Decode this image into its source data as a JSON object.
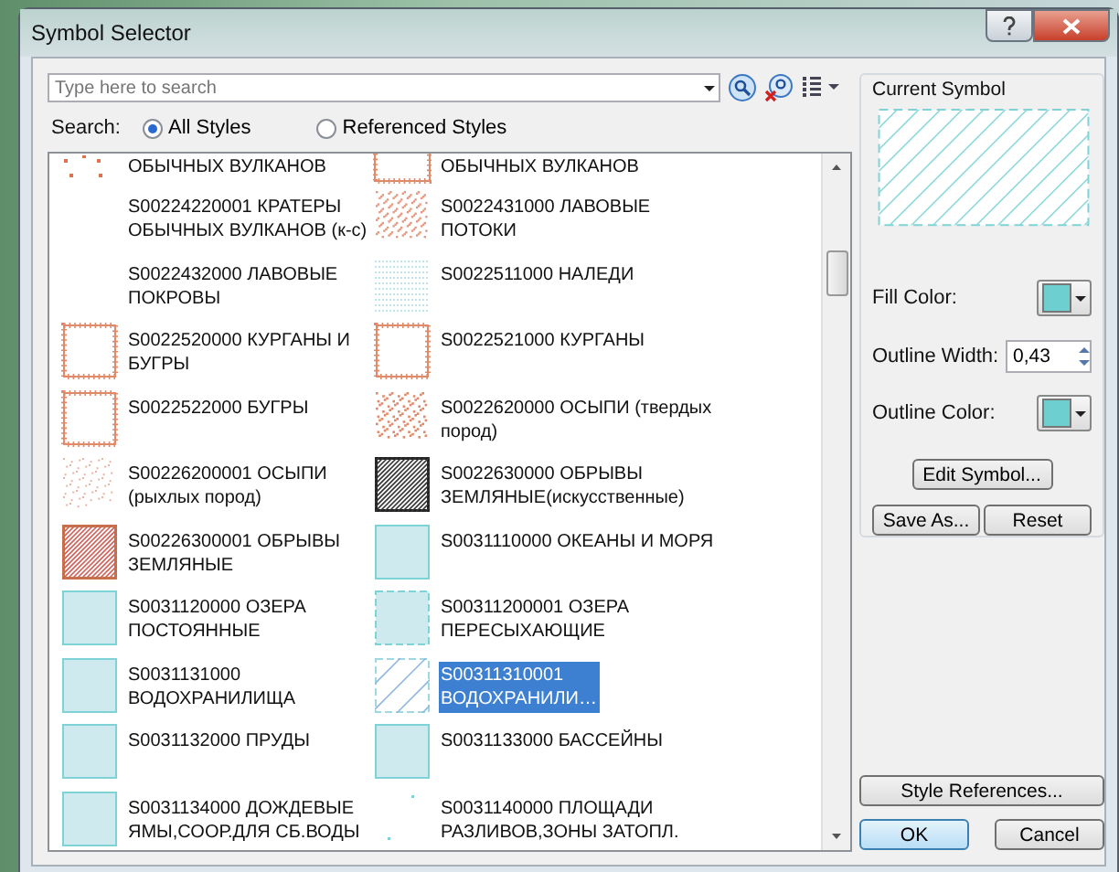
{
  "window": {
    "title": "Symbol Selector"
  },
  "search": {
    "placeholder": "Type here to search"
  },
  "search_scope": {
    "label": "Search:",
    "options": [
      {
        "label": "All Styles",
        "selected": true
      },
      {
        "label": "Referenced Styles",
        "selected": false
      }
    ]
  },
  "symbols": [
    {
      "kind": "volcano_dots",
      "label": "ОБЫЧНЫХ ВУЛКАНОВ",
      "selected": false
    },
    {
      "kind": "tick_box_cut",
      "label": "ОБЫЧНЫХ ВУЛКАНОВ",
      "selected": false
    },
    {
      "kind": "blank",
      "label": "S00224220001 КРАТЕРЫ\nОБЫЧНЫХ ВУЛКАНОВ (к-с)",
      "selected": false
    },
    {
      "kind": "lava",
      "label": "S0022431000 ЛАВОВЫЕ\nПОТОКИ",
      "selected": false
    },
    {
      "kind": "blank",
      "label": "S0022432000 ЛАВОВЫЕ\nПОКРОВЫ",
      "selected": false
    },
    {
      "kind": "ice",
      "label": "S0022511000 НАЛЕДИ",
      "selected": false
    },
    {
      "kind": "tick_box",
      "label": "S0022520000 КУРГАНЫ И\nБУГРЫ",
      "selected": false
    },
    {
      "kind": "tick_box",
      "label": "S0022521000 КУРГАНЫ",
      "selected": false
    },
    {
      "kind": "tick_box",
      "label": "S0022522000 БУГРЫ",
      "selected": false
    },
    {
      "kind": "scree",
      "label": "S0022620000 ОСЫПИ (твердых\nпород)",
      "selected": false
    },
    {
      "kind": "scree_sparse",
      "label": "S00226200001 ОСЫПИ\n(рыхлых пород)",
      "selected": false
    },
    {
      "kind": "hatch_black",
      "label": "S0022630000 ОБРЫВЫ\nЗЕМЛЯНЫЕ(искусственные)",
      "selected": false
    },
    {
      "kind": "hatch_brown",
      "label": "S00226300001 ОБРЫВЫ\nЗЕМЛЯНЫЕ",
      "selected": false
    },
    {
      "kind": "water",
      "label": "S0031110000 ОКЕАНЫ И МОРЯ",
      "selected": false
    },
    {
      "kind": "water",
      "label": "S0031120000 ОЗЕРА\nПОСТОЯННЫЕ",
      "selected": false
    },
    {
      "kind": "water_dashed",
      "label": "S00311200001 ОЗЕРА\nПЕРЕСЫХАЮЩИЕ",
      "selected": false
    },
    {
      "kind": "water",
      "label": "S0031131000\nВОДОХРАНИЛИЩА",
      "selected": false
    },
    {
      "kind": "water_hatch",
      "label": "S00311310001\nВОДОХРАНИЛИ…",
      "selected": true
    },
    {
      "kind": "water",
      "label": "S0031132000 ПРУДЫ",
      "selected": false
    },
    {
      "kind": "water",
      "label": "S0031133000 БАССЕЙНЫ",
      "selected": false
    },
    {
      "kind": "water",
      "label": "S0031134000 ДОЖДЕВЫЕ\nЯМЫ,СООР.ДЛЯ СБ.ВОДЫ",
      "selected": false
    },
    {
      "kind": "flood",
      "label": "S0031140000 ПЛОЩАДИ\nРАЗЛИВОВ,ЗОНЫ ЗАТОПЛ.",
      "selected": false
    }
  ],
  "current_symbol": {
    "title": "Current Symbol",
    "fill_color": {
      "label": "Fill Color:",
      "color": "#6ecfd0"
    },
    "outline_width": {
      "label": "Outline Width:",
      "value": "0,43"
    },
    "outline_color": {
      "label": "Outline Color:",
      "color": "#6ecfd0"
    },
    "buttons": [
      "Edit Symbol...",
      "Save As...",
      "Reset"
    ]
  },
  "buttons": [
    {
      "label": "Style References...",
      "default": false
    },
    {
      "label": "OK",
      "default": true
    },
    {
      "label": "Cancel",
      "default": false
    }
  ]
}
